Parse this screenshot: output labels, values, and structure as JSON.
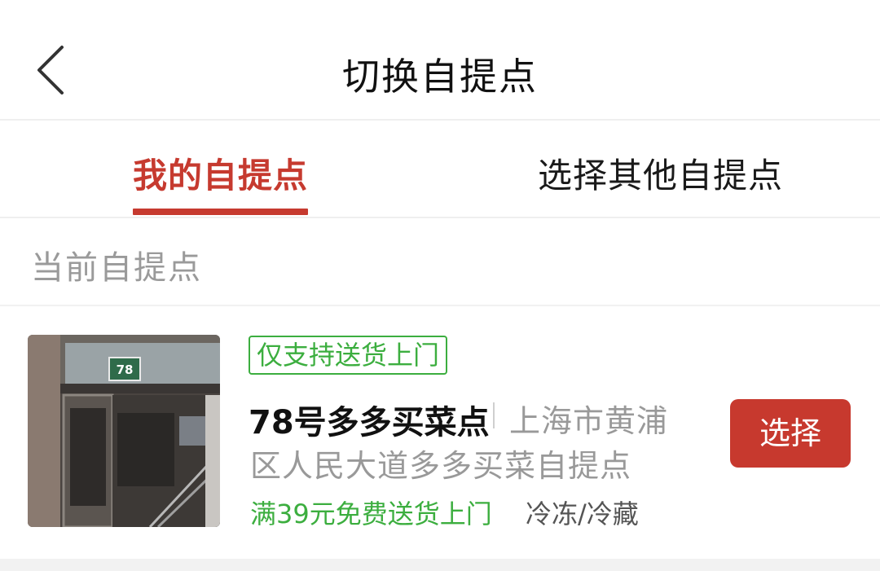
{
  "header": {
    "back_icon": "chevron-left-icon",
    "title": "切换自提点"
  },
  "tabs": [
    {
      "label": "我的自提点",
      "active": true
    },
    {
      "label": "选择其他自提点",
      "active": false
    }
  ],
  "section": {
    "label": "当前自提点"
  },
  "pickup_point": {
    "photo_text": "78",
    "tag": "仅支持送货上门",
    "name": "78号多多买菜点",
    "address_line1": "上海市黄浦",
    "address_line2": "区人民大道多多买菜自提点",
    "promo": "满39元免费送货上门",
    "storage": "冷冻/冷藏",
    "select_label": "选择"
  },
  "colors": {
    "accent_red": "#c63a2f",
    "green": "#3cae3f",
    "muted_gray": "#999999"
  }
}
